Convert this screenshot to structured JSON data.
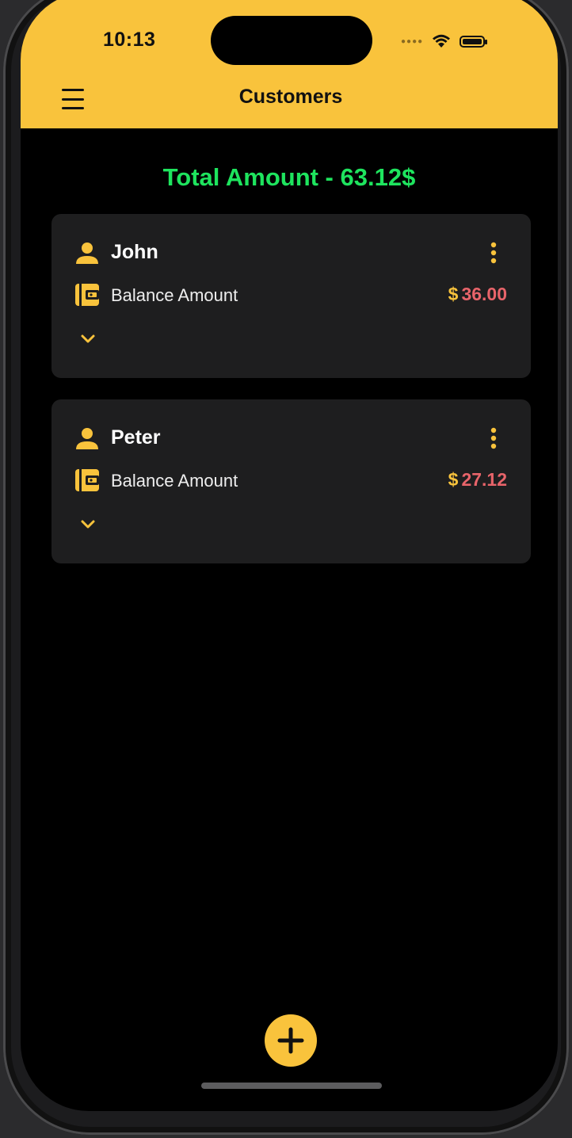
{
  "status_bar": {
    "time": "10:13",
    "icons": [
      "signal-dots-icon",
      "wifi-icon",
      "battery-icon"
    ]
  },
  "header": {
    "title": "Customers",
    "menu_icon": "hamburger-menu-icon",
    "background_color": "#f9c33c"
  },
  "summary": {
    "total_text": "Total Amount - 63.12$",
    "color": "#1ee45e"
  },
  "customers": [
    {
      "name": "John",
      "balance_label": "Balance Amount",
      "currency": "$",
      "amount": "36.00",
      "icons": [
        "person-icon",
        "wallet-icon",
        "more-vertical-icon",
        "chevron-down-icon"
      ]
    },
    {
      "name": "Peter",
      "balance_label": "Balance Amount",
      "currency": "$",
      "amount": "27.12",
      "icons": [
        "person-icon",
        "wallet-icon",
        "more-vertical-icon",
        "chevron-down-icon"
      ]
    }
  ],
  "fab": {
    "icon": "plus-icon"
  },
  "colors": {
    "accent": "#f9c33c",
    "amount": "#e8646a",
    "card": "#1e1e1f",
    "background": "#000000"
  }
}
